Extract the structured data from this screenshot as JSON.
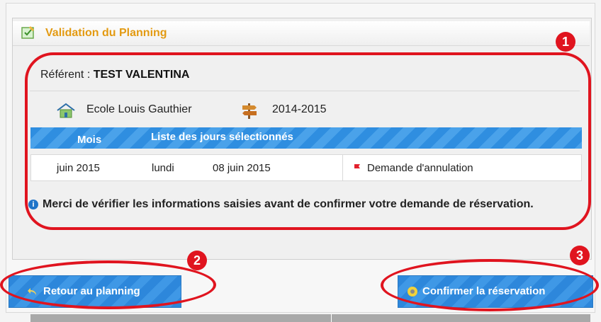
{
  "panel": {
    "title": "Validation du Planning",
    "referent_label": "Référent :",
    "referent_name": "TEST VALENTINA",
    "school": "Ecole Louis Gauthier",
    "year": "2014-2015",
    "table": {
      "headers": [
        "Mois",
        "Liste des jours sélectionnés"
      ],
      "rows": [
        {
          "mois": "juin 2015",
          "day": "lundi",
          "date": "08 juin 2015",
          "status": "Demande d'annulation"
        }
      ]
    },
    "info_message": "Merci de vérifier les informations saisies avant de confirmer votre demande de réservation."
  },
  "buttons": {
    "back": "Retour au planning",
    "confirm": "Confirmer la réservation"
  },
  "annotations": [
    "1",
    "2",
    "3"
  ],
  "colors": {
    "title": "#e39a12",
    "button_blue": "#2d87db",
    "annotation_red": "#e0141f",
    "status_flag": "#e2202c"
  },
  "icons": [
    "validation-icon",
    "school-icon",
    "signpost-icon",
    "flag-icon",
    "info-icon",
    "back-arrow-icon",
    "confirm-icon"
  ]
}
